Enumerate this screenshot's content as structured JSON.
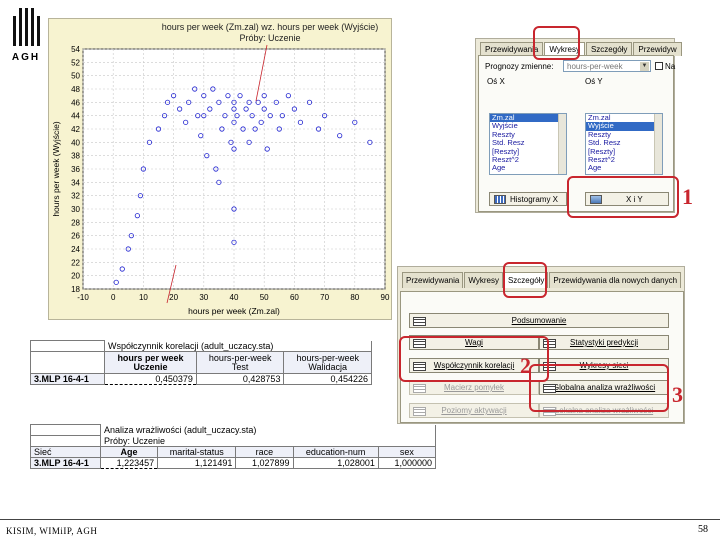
{
  "logo": {
    "text": "AGH"
  },
  "chart_data": {
    "type": "scatter",
    "title": "hours per week (Zm.zal) wz. hours per week (Wyjście)",
    "subtitle": "Próby: Uczenie",
    "xlabel": "hours per week (Zm.zal)",
    "ylabel": "hours per week (Wyjście)",
    "xlim": [
      -10,
      90
    ],
    "ylim": [
      18,
      54
    ],
    "xticks": [
      -10,
      0,
      10,
      20,
      30,
      40,
      50,
      60,
      70,
      80,
      90
    ],
    "yticks": [
      18,
      20,
      22,
      24,
      26,
      28,
      30,
      32,
      34,
      36,
      38,
      40,
      42,
      44,
      46,
      48,
      50,
      52,
      54
    ],
    "grid": true,
    "marker": "circle-open",
    "series": [
      {
        "points": [
          [
            1,
            19
          ],
          [
            3,
            21
          ],
          [
            5,
            24
          ],
          [
            6,
            26
          ],
          [
            8,
            29
          ],
          [
            9,
            32
          ],
          [
            10,
            36
          ],
          [
            12,
            40
          ],
          [
            15,
            42
          ],
          [
            17,
            44
          ],
          [
            18,
            46
          ],
          [
            20,
            47
          ],
          [
            22,
            45
          ],
          [
            24,
            43
          ],
          [
            25,
            46
          ],
          [
            27,
            48
          ],
          [
            28,
            44
          ],
          [
            29,
            41
          ],
          [
            30,
            47
          ],
          [
            30,
            44
          ],
          [
            31,
            38
          ],
          [
            32,
            45
          ],
          [
            33,
            48
          ],
          [
            34,
            36
          ],
          [
            35,
            46
          ],
          [
            35,
            34
          ],
          [
            36,
            42
          ],
          [
            37,
            44
          ],
          [
            38,
            47
          ],
          [
            39,
            40
          ],
          [
            40,
            45
          ],
          [
            40,
            46
          ],
          [
            40,
            43
          ],
          [
            40,
            39
          ],
          [
            40,
            30
          ],
          [
            40,
            25
          ],
          [
            41,
            44
          ],
          [
            42,
            47
          ],
          [
            43,
            42
          ],
          [
            44,
            45
          ],
          [
            45,
            46
          ],
          [
            45,
            40
          ],
          [
            46,
            44
          ],
          [
            47,
            42
          ],
          [
            48,
            46
          ],
          [
            49,
            43
          ],
          [
            50,
            45
          ],
          [
            50,
            47
          ],
          [
            51,
            39
          ],
          [
            52,
            44
          ],
          [
            54,
            46
          ],
          [
            55,
            42
          ],
          [
            56,
            44
          ],
          [
            58,
            47
          ],
          [
            60,
            45
          ],
          [
            62,
            43
          ],
          [
            65,
            46
          ],
          [
            68,
            42
          ],
          [
            70,
            44
          ],
          [
            75,
            41
          ],
          [
            80,
            43
          ],
          [
            85,
            40
          ]
        ]
      }
    ]
  },
  "dialog_charts": {
    "tabs": [
      "Przewidywania",
      "Wykresy",
      "Szczegóły",
      "Przewidyw"
    ],
    "active_tab": 1,
    "target_label": "Prognozy zmienne:",
    "target_value": "hours-per-week",
    "checkbox_label": "Na",
    "axis_x_label": "Oś X",
    "axis_y_label": "Oś Y",
    "list_x": [
      "Zm.zal",
      "Wyjście",
      "Reszty",
      "Std. Resz",
      "[Reszty]",
      "Reszt^2",
      "Age"
    ],
    "list_x_selected": 0,
    "list_y": [
      "Zm.zal",
      "Wyjście",
      "Reszty",
      "Std. Resz",
      "[Reszty]",
      "Reszt^2",
      "Age"
    ],
    "list_y_selected": 1,
    "histogram_button": "Histogramy X",
    "xy_button": "X i Y"
  },
  "dialog_details": {
    "tabs": [
      "Przewidywania",
      "Wykresy",
      "Szczegóły",
      "Przewidywania dla nowych danych"
    ],
    "active_tab": 2,
    "buttons": [
      {
        "label": "Podsumowanie",
        "enabled": true
      },
      {
        "label": "Wagi",
        "enabled": true
      },
      {
        "label": "Statystyki predykcji",
        "enabled": true
      },
      {
        "label": "Współczynnik korelacji",
        "enabled": true
      },
      {
        "label": "Wykresy sieci",
        "enabled": true
      },
      {
        "label": "Macierz pomyłek",
        "enabled": false
      },
      {
        "label": "Globalna analiza wrażliwości",
        "enabled": true
      },
      {
        "label": "Poziomy aktywacji",
        "enabled": false
      },
      {
        "label": "Lokalna analiza wrażliwości",
        "enabled": false
      }
    ]
  },
  "callouts": {
    "one": "1",
    "two": "2",
    "three": "3"
  },
  "table_correlation": {
    "caption": "Współczynnik korelacji (adult_uczacy.sta)",
    "headers": [
      "hours per week\nUczenie",
      "hours-per-week\nTest",
      "hours-per-week\nWalidacja"
    ],
    "row_label": "3.MLP 16-4-1",
    "values": [
      "0,450379",
      "0,428753",
      "0,454226"
    ]
  },
  "table_sensitivity": {
    "caption": "Analiza wrażliwości (adult_uczacy.sta)",
    "subcaption": "Próby: Uczenie",
    "row_header": "Sieć",
    "headers": [
      "Age",
      "marital-status",
      "race",
      "education-num",
      "sex"
    ],
    "row_label": "3.MLP 16-4-1",
    "values": [
      "1,223457",
      "1,121491",
      "1,027899",
      "1,028001",
      "1,000000"
    ]
  },
  "footer": {
    "left": "KISIM, WIMiIP, AGH",
    "page": "58"
  },
  "colors": {
    "accent": "#c8262e",
    "scatter": "#1f22d0",
    "chart_bg": "#f7f3d0"
  }
}
